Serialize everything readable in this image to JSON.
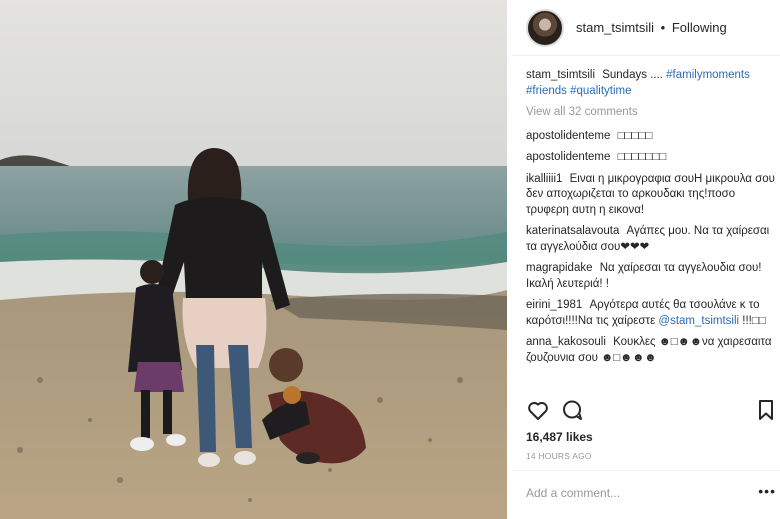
{
  "post": {
    "username": "stam_tsimtsili",
    "separator": "•",
    "follow_status": "Following",
    "caption_user": "stam_tsimtsili",
    "caption_text": "Sundays ....",
    "hashtags": [
      "#familymoments",
      "#friends",
      "#qualitytime"
    ],
    "view_all": "View all 32 comments",
    "likes": "16,487 likes",
    "time": "14 HOURS AGO",
    "add_comment_placeholder": "Add a comment...",
    "more_label": "•••"
  },
  "comments": [
    {
      "user": "apostolidenteme",
      "text": "□□□□□"
    },
    {
      "user": "apostolidenteme",
      "text": "□□□□□□□"
    },
    {
      "user": "ikalliiii1",
      "text": "Ειναι η μικρογραφια σουΗ μικρουλα σου δεν αποχωριζεται το αρκουδακι της!ποσο τρυφερη αυτη η εικονα!"
    },
    {
      "user": "katerinatsalavouta",
      "text": "Αγάπες μου. Να τα χαίρεσαι τα αγγελούδια σου❤❤❤"
    },
    {
      "user": "magrapidake",
      "text": "Να χαίρεσαι τα αγγελουδια σου! Ικαλή λευτεριά! !"
    },
    {
      "user": "eirini_1981",
      "text": "Αργότερα αυτές θα τσουλάνε κ το καρότσι!!!!Να τις χαίρεστε",
      "mention": "@stam_tsimtsili",
      "suffix": "!!!□□"
    },
    {
      "user": "anna_kakosouli",
      "text": "Κουκλες ☻□☻☻να χαιρεσαιτα ζουζουνια σου ☻□☻☻☻"
    }
  ],
  "icons": {
    "like": "heart-icon",
    "comment": "comment-bubble-icon",
    "save": "bookmark-icon"
  },
  "colors": {
    "link": "#2b6bb3",
    "muted": "#999999",
    "text": "#262626"
  }
}
